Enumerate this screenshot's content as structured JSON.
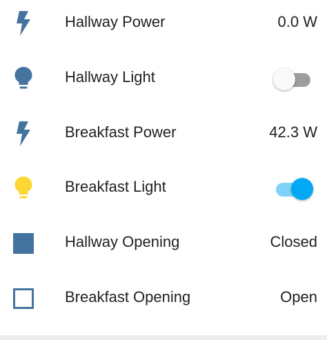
{
  "colors": {
    "icon_default": "#44739e",
    "icon_active": "#fdd835",
    "toggle_on": "#03a9f4",
    "toggle_off_track": "#9e9e9e"
  },
  "rows": [
    {
      "icon": "lightning-bolt-icon",
      "label": "Hallway Power",
      "value": "0.0 W"
    },
    {
      "icon": "lightbulb-icon",
      "label": "Hallway Light",
      "toggle": "off"
    },
    {
      "icon": "lightning-bolt-icon",
      "label": "Breakfast Power",
      "value": "42.3 W"
    },
    {
      "icon": "lightbulb-icon",
      "label": "Breakfast Light",
      "toggle": "on"
    },
    {
      "icon": "filled-square-icon",
      "label": "Hallway Opening",
      "value": "Closed"
    },
    {
      "icon": "empty-square-icon",
      "label": "Breakfast Opening",
      "value": "Open"
    }
  ]
}
